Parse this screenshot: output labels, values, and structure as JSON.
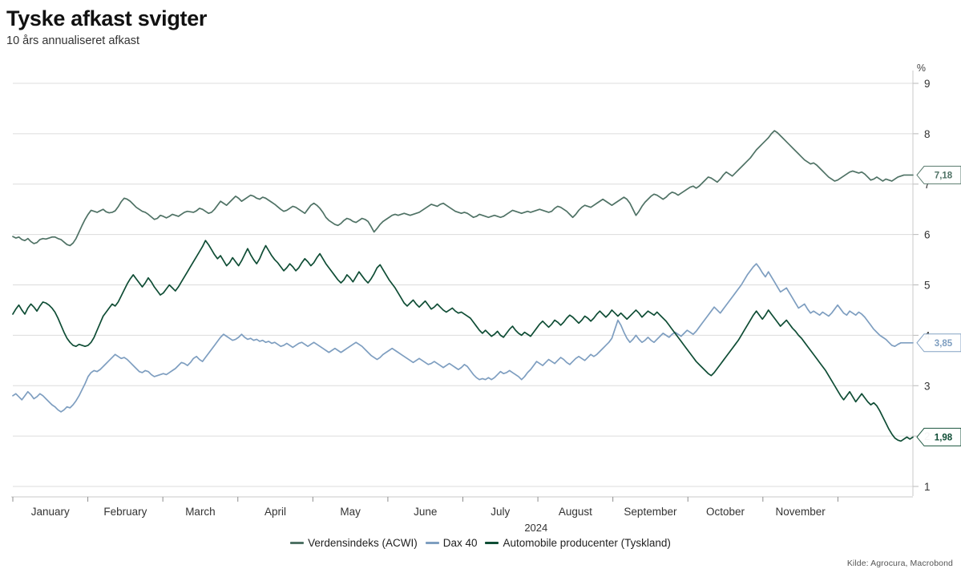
{
  "header": {
    "title": "Tyske afkast svigter",
    "subtitle": "10 års annualiseret afkast"
  },
  "axis": {
    "unit": "%",
    "year": "2024",
    "y_ticks": [
      "9",
      "8",
      "7",
      "6",
      "5",
      "4",
      "3",
      "2",
      "1"
    ],
    "x_ticks": [
      "January",
      "February",
      "March",
      "April",
      "May",
      "June",
      "July",
      "August",
      "September",
      "October",
      "November"
    ]
  },
  "legend": [
    {
      "label": "Verdensindeks (ACWI)",
      "color": "#4f7265"
    },
    {
      "label": "Dax 40",
      "color": "#7e9ec0"
    },
    {
      "label": "Automobile producenter (Tyskland)",
      "color": "#0f4d35"
    }
  ],
  "callouts": [
    {
      "value": "7,18",
      "color": "#4f7265",
      "y": 7.18
    },
    {
      "value": "3,85",
      "color": "#7e9ec0",
      "y": 3.85
    },
    {
      "value": "1,98",
      "color": "#0f4d35",
      "y": 1.98
    }
  ],
  "source": "Kilde: Agrocura, Macrobond",
  "chart_data": {
    "type": "line",
    "title": "Tyske afkast svigter",
    "subtitle": "10 års annualiseret afkast",
    "xlabel": "2024",
    "ylabel": "%",
    "ylim": [
      1,
      9
    ],
    "grid": true,
    "legend_position": "bottom",
    "x_tick_labels": [
      "January",
      "February",
      "March",
      "April",
      "May",
      "June",
      "July",
      "August",
      "September",
      "October",
      "November"
    ],
    "y_tick_values": [
      1,
      2,
      3,
      4,
      5,
      6,
      7,
      8,
      9
    ],
    "series": [
      {
        "name": "Verdensindeks (ACWI)",
        "color": "#4f7265",
        "final_value": 7.18,
        "values": [
          5.96,
          5.93,
          5.95,
          5.9,
          5.88,
          5.92,
          5.86,
          5.82,
          5.84,
          5.9,
          5.92,
          5.91,
          5.93,
          5.95,
          5.95,
          5.92,
          5.9,
          5.85,
          5.8,
          5.78,
          5.83,
          5.92,
          6.05,
          6.18,
          6.3,
          6.4,
          6.48,
          6.46,
          6.44,
          6.47,
          6.5,
          6.45,
          6.43,
          6.44,
          6.47,
          6.55,
          6.65,
          6.72,
          6.7,
          6.66,
          6.6,
          6.54,
          6.5,
          6.46,
          6.44,
          6.4,
          6.35,
          6.3,
          6.32,
          6.38,
          6.36,
          6.33,
          6.36,
          6.4,
          6.38,
          6.36,
          6.4,
          6.44,
          6.46,
          6.45,
          6.44,
          6.47,
          6.52,
          6.5,
          6.46,
          6.42,
          6.44,
          6.5,
          6.58,
          6.66,
          6.62,
          6.58,
          6.64,
          6.7,
          6.76,
          6.72,
          6.66,
          6.7,
          6.74,
          6.78,
          6.76,
          6.72,
          6.7,
          6.74,
          6.72,
          6.68,
          6.64,
          6.6,
          6.55,
          6.5,
          6.46,
          6.48,
          6.52,
          6.56,
          6.54,
          6.5,
          6.46,
          6.42,
          6.5,
          6.58,
          6.62,
          6.58,
          6.52,
          6.44,
          6.34,
          6.28,
          6.24,
          6.2,
          6.18,
          6.22,
          6.28,
          6.32,
          6.3,
          6.26,
          6.24,
          6.28,
          6.32,
          6.3,
          6.26,
          6.16,
          6.05,
          6.12,
          6.2,
          6.26,
          6.3,
          6.34,
          6.38,
          6.4,
          6.38,
          6.4,
          6.42,
          6.4,
          6.38,
          6.4,
          6.42,
          6.44,
          6.48,
          6.52,
          6.56,
          6.6,
          6.58,
          6.56,
          6.6,
          6.62,
          6.58,
          6.54,
          6.5,
          6.46,
          6.44,
          6.42,
          6.44,
          6.42,
          6.38,
          6.34,
          6.36,
          6.4,
          6.38,
          6.36,
          6.34,
          6.36,
          6.38,
          6.36,
          6.34,
          6.36,
          6.4,
          6.44,
          6.48,
          6.46,
          6.44,
          6.42,
          6.44,
          6.46,
          6.44,
          6.46,
          6.48,
          6.5,
          6.48,
          6.46,
          6.44,
          6.46,
          6.52,
          6.56,
          6.54,
          6.5,
          6.46,
          6.4,
          6.34,
          6.4,
          6.48,
          6.54,
          6.58,
          6.56,
          6.54,
          6.58,
          6.62,
          6.66,
          6.7,
          6.66,
          6.62,
          6.58,
          6.62,
          6.66,
          6.7,
          6.74,
          6.7,
          6.62,
          6.5,
          6.38,
          6.46,
          6.56,
          6.64,
          6.7,
          6.76,
          6.8,
          6.78,
          6.74,
          6.7,
          6.74,
          6.8,
          6.84,
          6.82,
          6.78,
          6.82,
          6.86,
          6.9,
          6.94,
          6.96,
          6.92,
          6.96,
          7.02,
          7.08,
          7.14,
          7.12,
          7.08,
          7.04,
          7.1,
          7.18,
          7.24,
          7.2,
          7.16,
          7.22,
          7.28,
          7.34,
          7.4,
          7.46,
          7.52,
          7.6,
          7.68,
          7.74,
          7.8,
          7.86,
          7.92,
          8.0,
          8.06,
          8.02,
          7.96,
          7.9,
          7.84,
          7.78,
          7.72,
          7.66,
          7.6,
          7.54,
          7.48,
          7.44,
          7.4,
          7.42,
          7.38,
          7.32,
          7.26,
          7.2,
          7.14,
          7.1,
          7.06,
          7.08,
          7.12,
          7.16,
          7.2,
          7.24,
          7.26,
          7.24,
          7.22,
          7.24,
          7.2,
          7.14,
          7.08,
          7.1,
          7.14,
          7.1,
          7.06,
          7.1,
          7.08,
          7.06,
          7.1,
          7.14,
          7.16,
          7.18,
          7.18,
          7.18,
          7.18
        ]
      },
      {
        "name": "Dax 40",
        "color": "#7e9ec0",
        "final_value": 3.85,
        "values": [
          2.8,
          2.84,
          2.78,
          2.72,
          2.8,
          2.88,
          2.82,
          2.74,
          2.78,
          2.84,
          2.8,
          2.74,
          2.68,
          2.62,
          2.58,
          2.52,
          2.48,
          2.52,
          2.58,
          2.56,
          2.62,
          2.7,
          2.8,
          2.92,
          3.04,
          3.18,
          3.26,
          3.3,
          3.28,
          3.32,
          3.38,
          3.44,
          3.5,
          3.56,
          3.62,
          3.58,
          3.54,
          3.56,
          3.52,
          3.46,
          3.4,
          3.34,
          3.28,
          3.26,
          3.3,
          3.28,
          3.22,
          3.18,
          3.2,
          3.22,
          3.24,
          3.22,
          3.26,
          3.3,
          3.34,
          3.4,
          3.46,
          3.44,
          3.4,
          3.46,
          3.54,
          3.58,
          3.52,
          3.48,
          3.56,
          3.64,
          3.72,
          3.8,
          3.88,
          3.96,
          4.02,
          3.98,
          3.94,
          3.9,
          3.92,
          3.96,
          4.02,
          3.96,
          3.92,
          3.94,
          3.9,
          3.92,
          3.88,
          3.9,
          3.86,
          3.88,
          3.84,
          3.86,
          3.82,
          3.78,
          3.8,
          3.84,
          3.8,
          3.76,
          3.8,
          3.84,
          3.86,
          3.82,
          3.78,
          3.82,
          3.86,
          3.82,
          3.78,
          3.74,
          3.7,
          3.66,
          3.7,
          3.74,
          3.7,
          3.66,
          3.7,
          3.74,
          3.78,
          3.82,
          3.86,
          3.82,
          3.78,
          3.72,
          3.66,
          3.6,
          3.56,
          3.52,
          3.56,
          3.62,
          3.66,
          3.7,
          3.74,
          3.7,
          3.66,
          3.62,
          3.58,
          3.54,
          3.5,
          3.46,
          3.5,
          3.54,
          3.5,
          3.46,
          3.42,
          3.44,
          3.48,
          3.44,
          3.4,
          3.36,
          3.4,
          3.44,
          3.4,
          3.36,
          3.32,
          3.36,
          3.42,
          3.38,
          3.3,
          3.22,
          3.16,
          3.12,
          3.14,
          3.12,
          3.16,
          3.12,
          3.16,
          3.22,
          3.28,
          3.24,
          3.26,
          3.3,
          3.26,
          3.22,
          3.18,
          3.12,
          3.18,
          3.26,
          3.32,
          3.4,
          3.48,
          3.44,
          3.4,
          3.46,
          3.52,
          3.48,
          3.44,
          3.5,
          3.56,
          3.52,
          3.46,
          3.42,
          3.48,
          3.54,
          3.58,
          3.54,
          3.5,
          3.56,
          3.62,
          3.58,
          3.62,
          3.68,
          3.74,
          3.8,
          3.86,
          3.94,
          4.12,
          4.3,
          4.2,
          4.06,
          3.94,
          3.86,
          3.92,
          4.0,
          3.92,
          3.86,
          3.9,
          3.96,
          3.9,
          3.86,
          3.92,
          3.98,
          4.04,
          4.0,
          3.96,
          4.02,
          4.06,
          4.02,
          3.98,
          4.04,
          4.1,
          4.06,
          4.02,
          4.08,
          4.16,
          4.24,
          4.32,
          4.4,
          4.48,
          4.56,
          4.5,
          4.44,
          4.52,
          4.6,
          4.68,
          4.76,
          4.84,
          4.92,
          5.0,
          5.1,
          5.2,
          5.28,
          5.36,
          5.42,
          5.34,
          5.24,
          5.16,
          5.26,
          5.16,
          5.06,
          4.96,
          4.86,
          4.9,
          4.94,
          4.84,
          4.74,
          4.64,
          4.54,
          4.58,
          4.62,
          4.52,
          4.44,
          4.48,
          4.44,
          4.4,
          4.46,
          4.42,
          4.38,
          4.44,
          4.52,
          4.6,
          4.52,
          4.44,
          4.4,
          4.48,
          4.44,
          4.4,
          4.46,
          4.42,
          4.36,
          4.28,
          4.2,
          4.12,
          4.06,
          4.0,
          3.96,
          3.92,
          3.86,
          3.8,
          3.78,
          3.82,
          3.85,
          3.85,
          3.85,
          3.85,
          3.85
        ]
      },
      {
        "name": "Automobile producenter (Tyskland)",
        "color": "#0f4d35",
        "final_value": 1.98,
        "values": [
          4.42,
          4.52,
          4.6,
          4.5,
          4.42,
          4.54,
          4.62,
          4.56,
          4.48,
          4.58,
          4.66,
          4.64,
          4.6,
          4.54,
          4.46,
          4.34,
          4.2,
          4.06,
          3.94,
          3.86,
          3.8,
          3.78,
          3.82,
          3.8,
          3.78,
          3.8,
          3.86,
          3.96,
          4.1,
          4.24,
          4.38,
          4.46,
          4.54,
          4.62,
          4.58,
          4.66,
          4.78,
          4.9,
          5.02,
          5.12,
          5.2,
          5.12,
          5.04,
          4.96,
          5.04,
          5.14,
          5.06,
          4.96,
          4.88,
          4.8,
          4.84,
          4.92,
          5.0,
          4.94,
          4.88,
          4.96,
          5.06,
          5.16,
          5.26,
          5.36,
          5.46,
          5.56,
          5.66,
          5.76,
          5.88,
          5.8,
          5.7,
          5.6,
          5.52,
          5.58,
          5.48,
          5.38,
          5.44,
          5.54,
          5.46,
          5.38,
          5.48,
          5.6,
          5.72,
          5.6,
          5.5,
          5.42,
          5.52,
          5.66,
          5.78,
          5.68,
          5.58,
          5.5,
          5.44,
          5.36,
          5.28,
          5.34,
          5.42,
          5.36,
          5.28,
          5.34,
          5.44,
          5.52,
          5.46,
          5.38,
          5.44,
          5.54,
          5.62,
          5.52,
          5.42,
          5.34,
          5.26,
          5.18,
          5.1,
          5.04,
          5.1,
          5.2,
          5.14,
          5.06,
          5.16,
          5.26,
          5.18,
          5.1,
          5.04,
          5.12,
          5.22,
          5.34,
          5.4,
          5.3,
          5.2,
          5.1,
          5.02,
          4.94,
          4.84,
          4.74,
          4.64,
          4.58,
          4.64,
          4.7,
          4.62,
          4.56,
          4.62,
          4.68,
          4.6,
          4.52,
          4.56,
          4.62,
          4.56,
          4.5,
          4.46,
          4.5,
          4.54,
          4.48,
          4.44,
          4.46,
          4.42,
          4.38,
          4.34,
          4.26,
          4.18,
          4.1,
          4.04,
          4.1,
          4.04,
          3.98,
          4.02,
          4.08,
          4.0,
          3.96,
          4.04,
          4.12,
          4.18,
          4.1,
          4.04,
          4.0,
          4.06,
          4.02,
          3.98,
          4.06,
          4.14,
          4.22,
          4.28,
          4.22,
          4.16,
          4.22,
          4.3,
          4.26,
          4.2,
          4.26,
          4.34,
          4.4,
          4.36,
          4.3,
          4.24,
          4.3,
          4.38,
          4.34,
          4.28,
          4.34,
          4.42,
          4.48,
          4.42,
          4.36,
          4.42,
          4.5,
          4.44,
          4.38,
          4.44,
          4.38,
          4.32,
          4.38,
          4.44,
          4.5,
          4.44,
          4.36,
          4.42,
          4.48,
          4.44,
          4.4,
          4.46,
          4.4,
          4.34,
          4.28,
          4.2,
          4.12,
          4.04,
          3.96,
          3.88,
          3.8,
          3.72,
          3.64,
          3.56,
          3.48,
          3.42,
          3.36,
          3.3,
          3.24,
          3.2,
          3.26,
          3.34,
          3.42,
          3.5,
          3.58,
          3.66,
          3.74,
          3.82,
          3.9,
          4.0,
          4.1,
          4.2,
          4.3,
          4.4,
          4.48,
          4.4,
          4.32,
          4.4,
          4.5,
          4.42,
          4.34,
          4.26,
          4.18,
          4.24,
          4.3,
          4.22,
          4.14,
          4.08,
          4.0,
          3.94,
          3.86,
          3.78,
          3.7,
          3.62,
          3.54,
          3.46,
          3.38,
          3.3,
          3.2,
          3.1,
          3.0,
          2.9,
          2.8,
          2.72,
          2.8,
          2.88,
          2.78,
          2.68,
          2.76,
          2.84,
          2.76,
          2.68,
          2.62,
          2.66,
          2.6,
          2.5,
          2.38,
          2.26,
          2.14,
          2.04,
          1.96,
          1.92,
          1.9,
          1.94,
          1.98,
          1.94,
          1.98
        ]
      }
    ]
  }
}
